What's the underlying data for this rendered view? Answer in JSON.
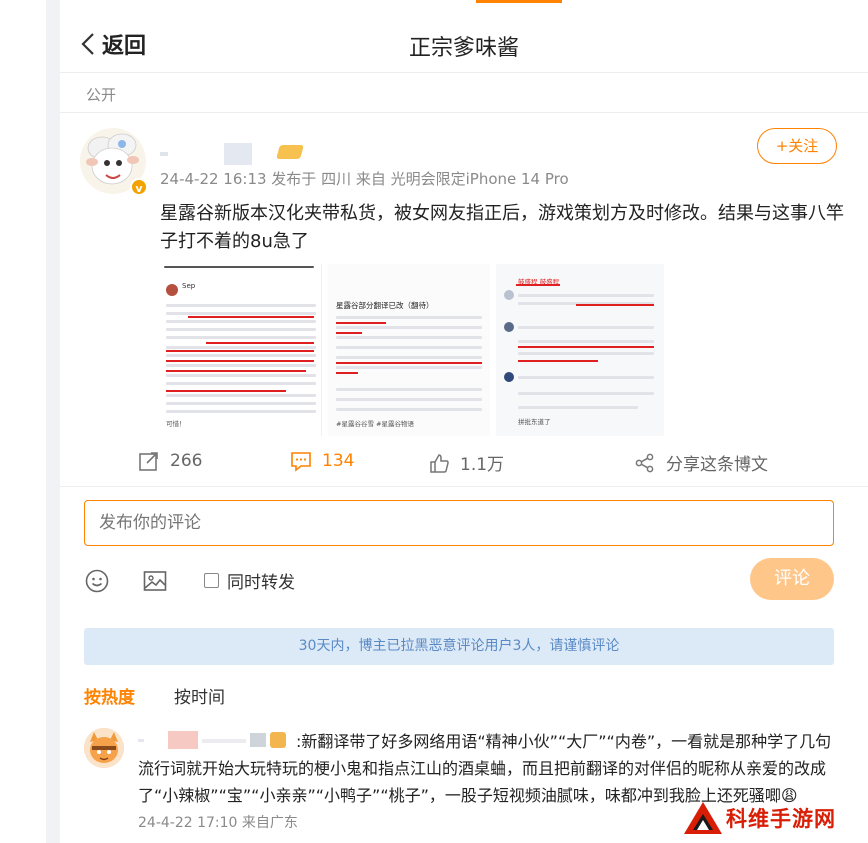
{
  "header": {
    "back_label": "返回",
    "title": "正宗爹味酱"
  },
  "post": {
    "visibility": "公开",
    "meta": "24-4-22 16:13 发布于 四川 来自 光明会限定iPhone 14 Pro",
    "follow_label": "+关注",
    "text": "星露谷新版本汉化夹带私货，被女网友指正后，游戏策划方及时修改。结果与这事八竿子打不着的8u急了",
    "verified_badge": "v",
    "images": {
      "t1": {
        "header": "Sep",
        "caption": "可惜！"
      },
      "t2": {
        "header": "星露谷部分翻译已改（翻待）",
        "footer": "#星露谷谷雪 #星露谷物语"
      },
      "t3": {
        "header": "鼓盛程 鼓盛程",
        "footer": "拼批东道了"
      }
    }
  },
  "actions": {
    "repost_count": "266",
    "comment_count": "134",
    "like_count": "1.1万",
    "share_label": "分享这条博文"
  },
  "composer": {
    "placeholder": "发布你的评论",
    "repost_checkbox_label": "同时转发",
    "submit_label": "评论"
  },
  "notice": "30天内，博主已拉黑恶意评论用户3人，请谨慎评论",
  "sort_tabs": {
    "hot": "按热度",
    "time": "按时间"
  },
  "comments": [
    {
      "text": ":新翻译带了好多网络用语“精神小伙”“大厂”“内卷”，一看就是那种学了几句流行词就开始大玩特玩的梗小鬼和指点江山的酒桌蛐，而且把前翻译的对伴侣的昵称从亲爱的改成了“小辣椒”“宝”“小亲亲”“小鸭子”“桃子”，一股子短视频油腻味，味都冲到我脸上还死骚唧😩",
      "meta": "24-4-22 17:10 来自广东"
    }
  ],
  "watermark": "科维手游网",
  "colors": {
    "accent": "#ff8200",
    "notice_bg": "#dce9f7",
    "notice_text": "#5a8ac6",
    "watermark": "#d81e06"
  }
}
